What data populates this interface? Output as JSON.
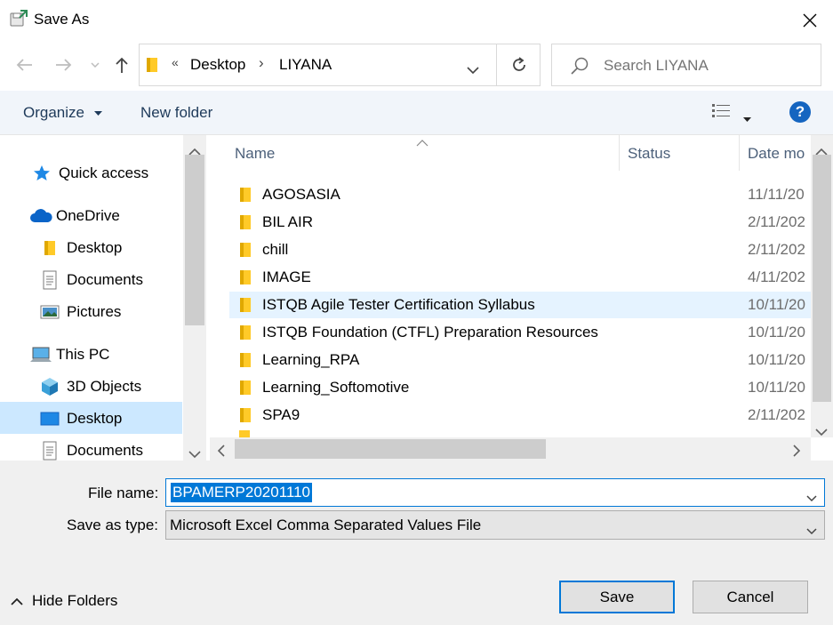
{
  "window": {
    "title": "Save As"
  },
  "nav": {
    "path_prefix": "«",
    "breadcrumb": [
      "Desktop",
      "LIYANA"
    ],
    "separator": "›",
    "search_placeholder": "Search LIYANA"
  },
  "toolbar": {
    "organize": "Organize",
    "new_folder": "New folder"
  },
  "sidebar": {
    "items": [
      {
        "label": "Quick access",
        "icon": "star-icon"
      },
      {
        "label": "OneDrive",
        "icon": "cloud-icon"
      },
      {
        "label": "Desktop",
        "icon": "folder-icon"
      },
      {
        "label": "Documents",
        "icon": "document-icon"
      },
      {
        "label": "Pictures",
        "icon": "pictures-icon"
      },
      {
        "label": "This PC",
        "icon": "computer-icon"
      },
      {
        "label": "3D Objects",
        "icon": "cube-icon"
      },
      {
        "label": "Desktop",
        "icon": "desktop-icon"
      },
      {
        "label": "Documents",
        "icon": "document-icon"
      }
    ],
    "selected_index": 7
  },
  "columns": {
    "name": "Name",
    "status": "Status",
    "date": "Date mo"
  },
  "files": [
    {
      "name": "AGOSASIA",
      "date": "11/11/20"
    },
    {
      "name": "BIL AIR",
      "date": "2/11/202"
    },
    {
      "name": "chill",
      "date": "2/11/202"
    },
    {
      "name": "IMAGE",
      "date": "4/11/202"
    },
    {
      "name": "ISTQB Agile Tester Certification Syllabus",
      "date": "10/11/20"
    },
    {
      "name": "ISTQB Foundation (CTFL) Preparation Resources",
      "date": "10/11/20"
    },
    {
      "name": "Learning_RPA",
      "date": "10/11/20"
    },
    {
      "name": "Learning_Softomotive",
      "date": "10/11/20"
    },
    {
      "name": "SPA9",
      "date": "2/11/202"
    }
  ],
  "hovered_file_index": 4,
  "form": {
    "file_name_label": "File name:",
    "file_name_value": "BPAMERP20201110",
    "save_type_label": "Save as type:",
    "save_type_value": "Microsoft Excel Comma Separated Values File"
  },
  "footer": {
    "hide_folders": "Hide Folders",
    "save": "Save",
    "cancel": "Cancel"
  },
  "colors": {
    "accent": "#0078d7",
    "folder": "#ffca28",
    "selection": "#cce8ff",
    "hover": "#e5f3ff"
  }
}
